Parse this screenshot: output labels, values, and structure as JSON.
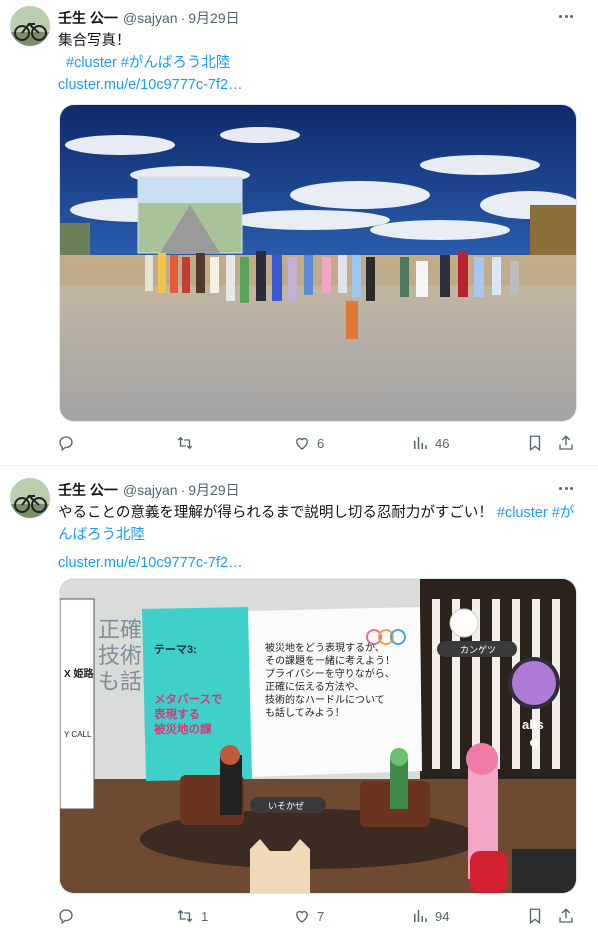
{
  "tweets": [
    {
      "author": "壬生 公一",
      "handle": "@sajyan",
      "sep": "·",
      "date": "9月29日",
      "text_line1": "集合写真！",
      "hashtags_line": "#cluster #がんばろう北陸",
      "url": "cluster.mu/e/10c9777c-7f2…",
      "reply_count": "",
      "retweet_count": "",
      "like_count": "6",
      "view_count": "46"
    },
    {
      "author": "壬生 公一",
      "handle": "@sajyan",
      "sep": "·",
      "date": "9月29日",
      "text_line1_plain": "やることの意義を理解が得られるまで説明し切る忍耐力がすごい！",
      "text_line1_tags": "#cluster #が",
      "text_line2": "んばろう北陸",
      "url": "cluster.mu/e/10c9777c-7f2…",
      "reply_count": "",
      "retweet_count": "1",
      "like_count": "7",
      "view_count": "94",
      "image": {
        "panel_left_title": "テーマ3:",
        "panel_left_body": "メタバースで\n表現する\n被災地の課",
        "panel_right_body": "被災地をどう表現するか、\nその課題を一緒に考えよう！\nプライバシーを守りながら、\n正確に伝える方法や、\n技術的なハードルについて\nも話してみよう！",
        "tag_kangetsu": "カンゲツ",
        "tag_alis": "alis",
        "tag_isokaze": "いそかぜ",
        "bg_text": "正確に\n技術的\nも話し",
        "sign_left": "X 姫路",
        "sign_left2": "Y CALL"
      }
    }
  ],
  "colors": {
    "link": "#1d9bf0",
    "muted": "#536471",
    "sky_top": "#1b3a78",
    "teal_panel": "#3fd1c9",
    "pink_text": "#d23a7a"
  }
}
